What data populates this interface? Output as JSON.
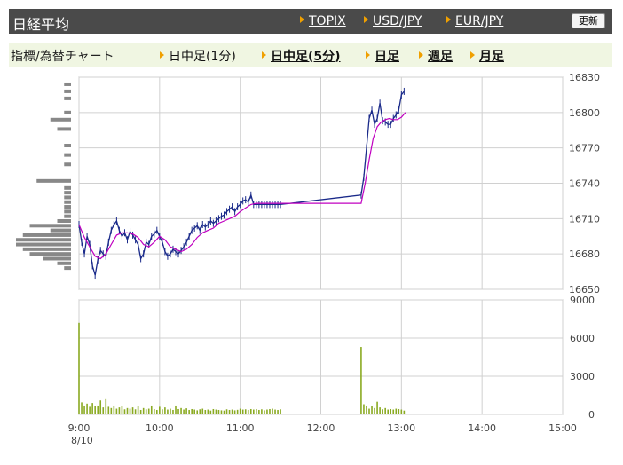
{
  "header": {
    "title": "日経平均",
    "links": [
      "TOPIX",
      "USD/JPY",
      "EUR/JPY"
    ],
    "refresh_label": "更新"
  },
  "tabs": {
    "label": "指標/為替チャート",
    "items": [
      {
        "label": "日中足(1分)",
        "active": false
      },
      {
        "label": "日中足(5分)",
        "active": true
      },
      {
        "label": "日足",
        "active": true
      },
      {
        "label": "週足",
        "active": true
      },
      {
        "label": "月足",
        "active": true
      }
    ]
  },
  "colors": {
    "candle_line": "#1a2a8a",
    "moving_average": "#c000c0",
    "volume_bar": "#8aaa22",
    "volume_profile": "#888888",
    "grid": "#d0d0d0"
  },
  "chart_data": {
    "type": "line",
    "date_label": "8/10",
    "x_ticks": [
      "9:00",
      "10:00",
      "11:00",
      "12:00",
      "13:00",
      "14:00",
      "15:00"
    ],
    "price": {
      "ylim": [
        16650,
        16830
      ],
      "y_ticks": [
        16650,
        16680,
        16710,
        16740,
        16770,
        16800,
        16830
      ],
      "x_minutes": [
        0,
        2,
        4,
        6,
        8,
        10,
        12,
        14,
        16,
        18,
        20,
        22,
        24,
        26,
        28,
        30,
        32,
        34,
        36,
        38,
        40,
        42,
        44,
        46,
        48,
        50,
        52,
        54,
        56,
        58,
        60,
        62,
        64,
        66,
        68,
        70,
        72,
        74,
        76,
        78,
        80,
        82,
        84,
        86,
        88,
        90,
        92,
        94,
        96,
        98,
        100,
        102,
        104,
        106,
        108,
        110,
        112,
        114,
        116,
        118,
        120,
        122,
        124,
        126,
        128,
        130,
        132,
        134,
        136,
        138,
        140,
        142,
        144,
        146,
        148,
        150,
        210,
        212,
        214,
        216,
        218,
        220,
        222,
        224,
        226,
        228,
        230,
        232,
        234,
        236,
        238,
        240,
        242
      ],
      "values": [
        16705,
        16690,
        16680,
        16695,
        16688,
        16670,
        16662,
        16675,
        16683,
        16680,
        16678,
        16690,
        16700,
        16705,
        16708,
        16700,
        16695,
        16698,
        16692,
        16699,
        16696,
        16692,
        16688,
        16676,
        16680,
        16690,
        16688,
        16695,
        16697,
        16700,
        16695,
        16690,
        16682,
        16678,
        16680,
        16684,
        16682,
        16680,
        16683,
        16686,
        16690,
        16695,
        16700,
        16702,
        16704,
        16700,
        16705,
        16703,
        16705,
        16708,
        16706,
        16708,
        16710,
        16712,
        16713,
        16716,
        16718,
        16720,
        16716,
        16720,
        16722,
        16725,
        16726,
        16724,
        16730,
        16722,
        16722,
        16722,
        16722,
        16722,
        16722,
        16722,
        16722,
        16722,
        16722,
        16722,
        16730,
        16745,
        16770,
        16795,
        16802,
        16790,
        16795,
        16808,
        16793,
        16792,
        16790,
        16790,
        16795,
        16798,
        16802,
        16815,
        16818
      ],
      "moving_average_x": [
        0,
        4,
        8,
        12,
        16,
        20,
        24,
        28,
        32,
        36,
        40,
        44,
        48,
        52,
        56,
        60,
        64,
        68,
        72,
        76,
        80,
        84,
        88,
        92,
        96,
        100,
        104,
        108,
        112,
        116,
        120,
        124,
        128,
        132,
        136,
        140,
        144,
        150,
        210,
        213,
        216,
        219,
        222,
        225,
        228,
        231,
        234,
        237,
        240,
        243
      ],
      "moving_average": [
        16705,
        16694,
        16686,
        16678,
        16676,
        16680,
        16688,
        16696,
        16698,
        16698,
        16697,
        16694,
        16688,
        16686,
        16690,
        16695,
        16692,
        16686,
        16684,
        16682,
        16684,
        16688,
        16694,
        16698,
        16700,
        16702,
        16706,
        16708,
        16710,
        16712,
        16716,
        16719,
        16722,
        16723,
        16723,
        16723,
        16723,
        16723,
        16723,
        16740,
        16760,
        16778,
        16788,
        16792,
        16794,
        16795,
        16794,
        16794,
        16796,
        16800
      ]
    },
    "volume": {
      "ylim": [
        0,
        9000
      ],
      "y_ticks": [
        0,
        3000,
        6000,
        9000
      ],
      "x_minutes": [
        0,
        2,
        4,
        6,
        8,
        10,
        12,
        14,
        16,
        18,
        20,
        22,
        24,
        26,
        28,
        30,
        32,
        34,
        36,
        38,
        40,
        42,
        44,
        46,
        48,
        50,
        52,
        54,
        56,
        58,
        60,
        62,
        64,
        66,
        68,
        70,
        72,
        74,
        76,
        78,
        80,
        82,
        84,
        86,
        88,
        90,
        92,
        94,
        96,
        98,
        100,
        102,
        104,
        106,
        108,
        110,
        112,
        114,
        116,
        118,
        120,
        122,
        124,
        126,
        128,
        130,
        132,
        134,
        136,
        138,
        140,
        142,
        144,
        146,
        148,
        150,
        210,
        212,
        214,
        216,
        218,
        220,
        222,
        224,
        226,
        228,
        230,
        232,
        234,
        236,
        238,
        240,
        242
      ],
      "values": [
        7200,
        950,
        700,
        850,
        600,
        900,
        650,
        700,
        1100,
        550,
        1200,
        600,
        500,
        700,
        450,
        550,
        650,
        400,
        500,
        450,
        550,
        400,
        650,
        350,
        500,
        400,
        450,
        700,
        420,
        350,
        600,
        400,
        550,
        380,
        450,
        350,
        700,
        420,
        500,
        380,
        480,
        350,
        420,
        380,
        320,
        400,
        450,
        350,
        380,
        300,
        420,
        380,
        350,
        320,
        300,
        400,
        350,
        380,
        320,
        360,
        450,
        380,
        400,
        350,
        420,
        380,
        420,
        350,
        400,
        320,
        380,
        420,
        450,
        380,
        350,
        400,
        5300,
        800,
        700,
        450,
        650,
        500,
        1000,
        550,
        400,
        500,
        380,
        420,
        380,
        450,
        420,
        380,
        300
      ]
    },
    "volume_profile": {
      "price_levels": [
        16668,
        16672,
        16676,
        16680,
        16684,
        16688,
        16692,
        16696,
        16700,
        16704,
        16708,
        16712,
        16716,
        16720,
        16724,
        16728,
        16732,
        16736,
        16742,
        16756,
        16764,
        16772,
        16786,
        16794,
        16800,
        16812,
        16818,
        16824
      ],
      "values": [
        1,
        2,
        4,
        6,
        7,
        8,
        8,
        7,
        3,
        6,
        2,
        1,
        1,
        1,
        1,
        1,
        1,
        1,
        5,
        1,
        1,
        1,
        2,
        3,
        1,
        1,
        1,
        1
      ]
    }
  }
}
